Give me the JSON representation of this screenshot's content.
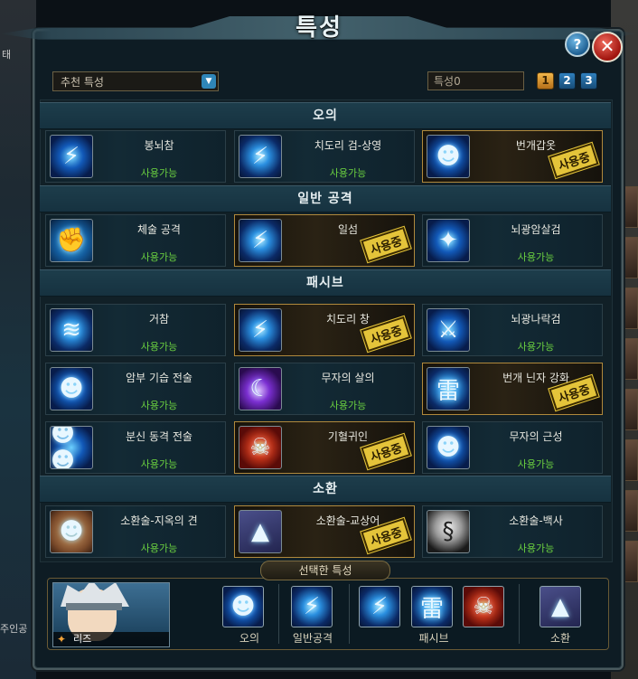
{
  "window": {
    "title": "특성",
    "help_label": "?",
    "close_label": "✕"
  },
  "controls": {
    "recommend_dropdown": "추천 특성",
    "preset_field": "특성0",
    "preset_buttons": [
      "1",
      "2",
      "3"
    ]
  },
  "sections": [
    {
      "title": "오의"
    },
    {
      "title": "일반 공격"
    },
    {
      "title": "패시브"
    },
    {
      "title": "소환"
    }
  ],
  "skills": {
    "ougi": [
      {
        "name": "봉뇌참",
        "status": "사용가능",
        "icon": "lightning-blade-icon"
      },
      {
        "name": "치도리 검-상영",
        "status": "사용가능",
        "icon": "chidori-sword-icon"
      },
      {
        "name": "번개갑옷",
        "status": "사용중",
        "icon": "lightning-armor-icon"
      }
    ],
    "normal": [
      {
        "name": "체술 공격",
        "status": "사용가능",
        "icon": "fist-icon"
      },
      {
        "name": "일섬",
        "status": "사용중",
        "icon": "flash-strike-icon"
      },
      {
        "name": "뇌광암살검",
        "status": "사용가능",
        "icon": "lightning-assassin-sword-icon"
      }
    ],
    "passive": [
      {
        "name": "거참",
        "status": "사용가능",
        "icon": "slash-wave-icon"
      },
      {
        "name": "치도리 창",
        "status": "사용중",
        "icon": "chidori-spear-icon"
      },
      {
        "name": "뇌광나락검",
        "status": "사용가능",
        "icon": "lightning-abyss-sword-icon"
      },
      {
        "name": "암부 기습 전술",
        "status": "사용가능",
        "icon": "anbu-ambush-icon"
      },
      {
        "name": "무자의 살의",
        "status": "사용가능",
        "icon": "killing-intent-icon"
      },
      {
        "name": "번개 닌자 강화",
        "status": "사용중",
        "icon": "lightning-kanji-icon"
      },
      {
        "name": "분신 동격 전술",
        "status": "사용가능",
        "icon": "clone-tactics-icon"
      },
      {
        "name": "기혈귀인",
        "status": "사용중",
        "icon": "demon-face-icon"
      },
      {
        "name": "무자의 근성",
        "status": "사용가능",
        "icon": "guts-icon"
      }
    ],
    "summon": [
      {
        "name": "소환술-지옥의 견",
        "status": "사용가능",
        "icon": "hell-dog-icon"
      },
      {
        "name": "소환술-교상어",
        "status": "사용중",
        "icon": "shark-icon"
      },
      {
        "name": "소환술-백사",
        "status": "사용가능",
        "icon": "white-snake-icon"
      }
    ]
  },
  "selected": {
    "label": "선택한 특성",
    "character_name": "리즈",
    "groups": [
      "오의",
      "일반공격",
      "패시브",
      "소환"
    ]
  },
  "background": {
    "left_text_1": "태",
    "left_text_2": "주인공"
  }
}
